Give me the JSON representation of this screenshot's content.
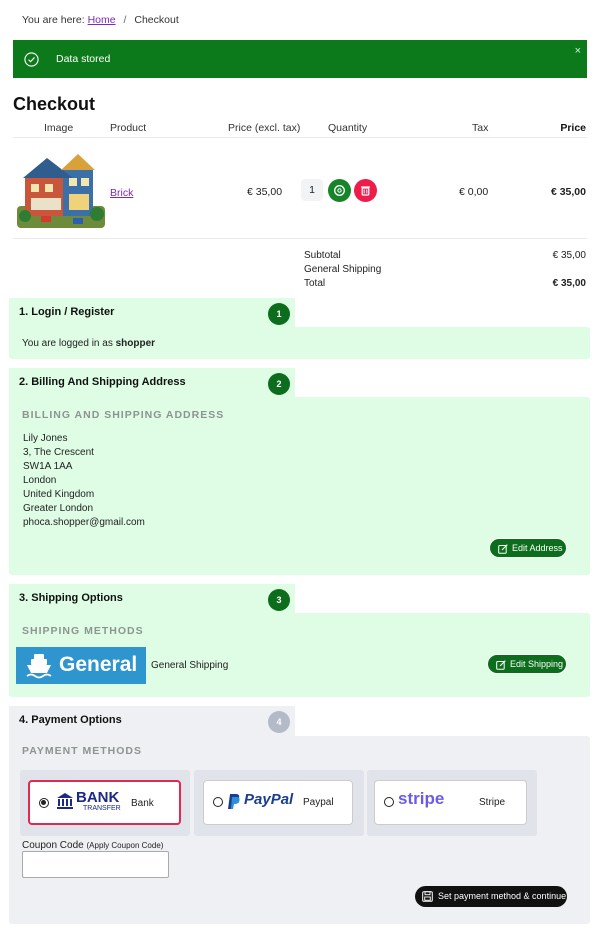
{
  "breadcrumb": {
    "prefix": "You are here:",
    "home": "Home",
    "separator": "/",
    "current": "Checkout"
  },
  "alert": {
    "message": "Data stored",
    "close": "×"
  },
  "page_title": "Checkout",
  "cart": {
    "headers": {
      "image": "Image",
      "product": "Product",
      "price_excl": "Price (excl. tax)",
      "quantity": "Quantity",
      "tax": "Tax",
      "price": "Price"
    },
    "items": [
      {
        "product": "Brick",
        "price_excl": "€ 35,00",
        "quantity": "1",
        "tax": "€ 0,00",
        "price": "€ 35,00"
      }
    ],
    "summary": {
      "subtotal_label": "Subtotal",
      "subtotal_value": "€ 35,00",
      "shipping_label": "General Shipping",
      "shipping_value": "",
      "total_label": "Total",
      "total_value": "€ 35,00"
    }
  },
  "steps": {
    "login": {
      "title": "1. Login / Register",
      "number": "1",
      "text_prefix": "You are logged in as",
      "username": "shopper"
    },
    "address": {
      "title": "2. Billing And Shipping Address",
      "number": "2",
      "heading": "BILLING AND SHIPPING ADDRESS",
      "lines": [
        "Lily Jones",
        "3, The Crescent",
        "SW1A 1AA",
        "London",
        "United Kingdom",
        "Greater London",
        "phoca.shopper@gmail.com"
      ],
      "edit_button": "Edit Address"
    },
    "shipping": {
      "title": "3. Shipping Options",
      "number": "3",
      "heading": "SHIPPING METHODS",
      "logo_text": "General",
      "method_name": "General Shipping",
      "edit_button": "Edit Shipping"
    },
    "payment": {
      "title": "4. Payment Options",
      "number": "4",
      "heading": "PAYMENT METHODS",
      "methods": [
        {
          "logo": "BANK",
          "logo_sub": "TRANSFER",
          "name": "Bank",
          "selected": true
        },
        {
          "logo": "PayPal",
          "name": "Paypal",
          "selected": false
        },
        {
          "logo": "stripe",
          "name": "Stripe",
          "selected": false
        }
      ],
      "coupon_label": "Coupon Code",
      "coupon_hint": "(Apply Coupon Code)",
      "coupon_value": "",
      "continue_button": "Set payment method & continue"
    }
  },
  "colors": {
    "success": "#0c7a1b",
    "step_bg": "#defde4",
    "step_grey": "#eef0f3",
    "danger": "#ee1c4a",
    "link": "#7a2ac0"
  }
}
